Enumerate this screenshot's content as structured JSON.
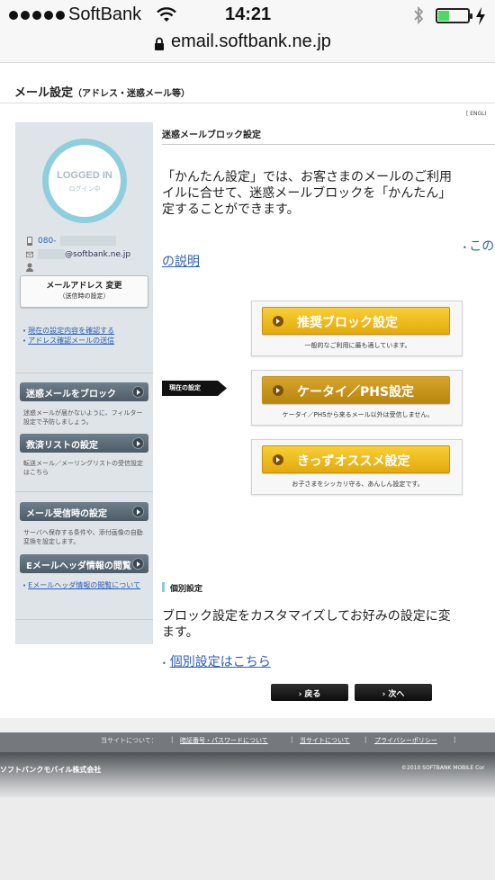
{
  "status_bar": {
    "carrier": "SoftBank",
    "time": "14:21",
    "battery_level": 0.35
  },
  "browser": {
    "url": "email.softbank.ne.jp"
  },
  "header": {
    "title": "メール設定",
    "subtitle": "（アドレス・迷惑メール等）",
    "english_link": "[ ENGLI"
  },
  "sidebar": {
    "badge_title": "LOGGED IN",
    "badge_sub": "ログイン中",
    "phone_prefix": "080-",
    "email_suffix": "@softbank.ne.jp",
    "change_address_button": "メールアドレス 変更",
    "change_address_note": "（送信時の設定）",
    "links": [
      "現在の設定内容を確認する",
      "アドレス確認メールの送信"
    ],
    "menu": [
      {
        "label": "迷惑メールをブロック",
        "desc": "迷惑メールが届かないように、フィルター設定で予防しましょう。"
      },
      {
        "label": "救済リストの設定",
        "desc": "転送メール／メーリングリストの受信設定はこちら"
      },
      {
        "label": "メール受信時の設定",
        "desc": "サーバへ保存する条件や、添付画像の自動変換を設定します。"
      },
      {
        "label": "Eメールヘッダ情報の閲覧",
        "desc": ""
      }
    ],
    "header_info_link": "Eメールヘッダ情報の閲覧について"
  },
  "main": {
    "section_title": "迷惑メールブロック設定",
    "intro_lines": [
      "「かんたん設定」では、お客さまのメールのご利用",
      "イルに合せて、迷惑メールブロックを「かんたん」",
      "定することができます。"
    ],
    "link_this": "この",
    "link_explain": "の説明",
    "current_tag": "現在の設定",
    "options": [
      {
        "label": "推奨ブロック設定",
        "desc": "一般的なご利用に最も適しています。",
        "active": false
      },
      {
        "label": "ケータイ／PHS設定",
        "desc": "ケータイ／PHSから来るメール以外は受信しません。",
        "active": true
      },
      {
        "label": "きっずオススメ設定",
        "desc": "お子さまをシッカリ守る、あんしん設定です。",
        "active": false
      }
    ],
    "individual_title": "個別設定",
    "individual_text_lines": [
      "ブロック設定をカスタマイズしてお好みの設定に変",
      "ます。"
    ],
    "individual_link": "個別設定はこちら",
    "back_button": "戻る",
    "next_button": "次へ"
  },
  "footer": {
    "about_label": "当サイトについて：",
    "links": [
      "暗証番号・パスワードについて",
      "当サイトについて",
      "プライバシーポリシー"
    ],
    "company": "ソフトバンクモバイル株式会社",
    "copyright": "©2010 SOFTBANK MOBILE Cor"
  },
  "colors": {
    "accent_blue": "#2b5fb8",
    "gold_button": "#e3aa0c",
    "sidebar_bg": "#dfe4e8",
    "badge_ring": "#8ecfde"
  }
}
